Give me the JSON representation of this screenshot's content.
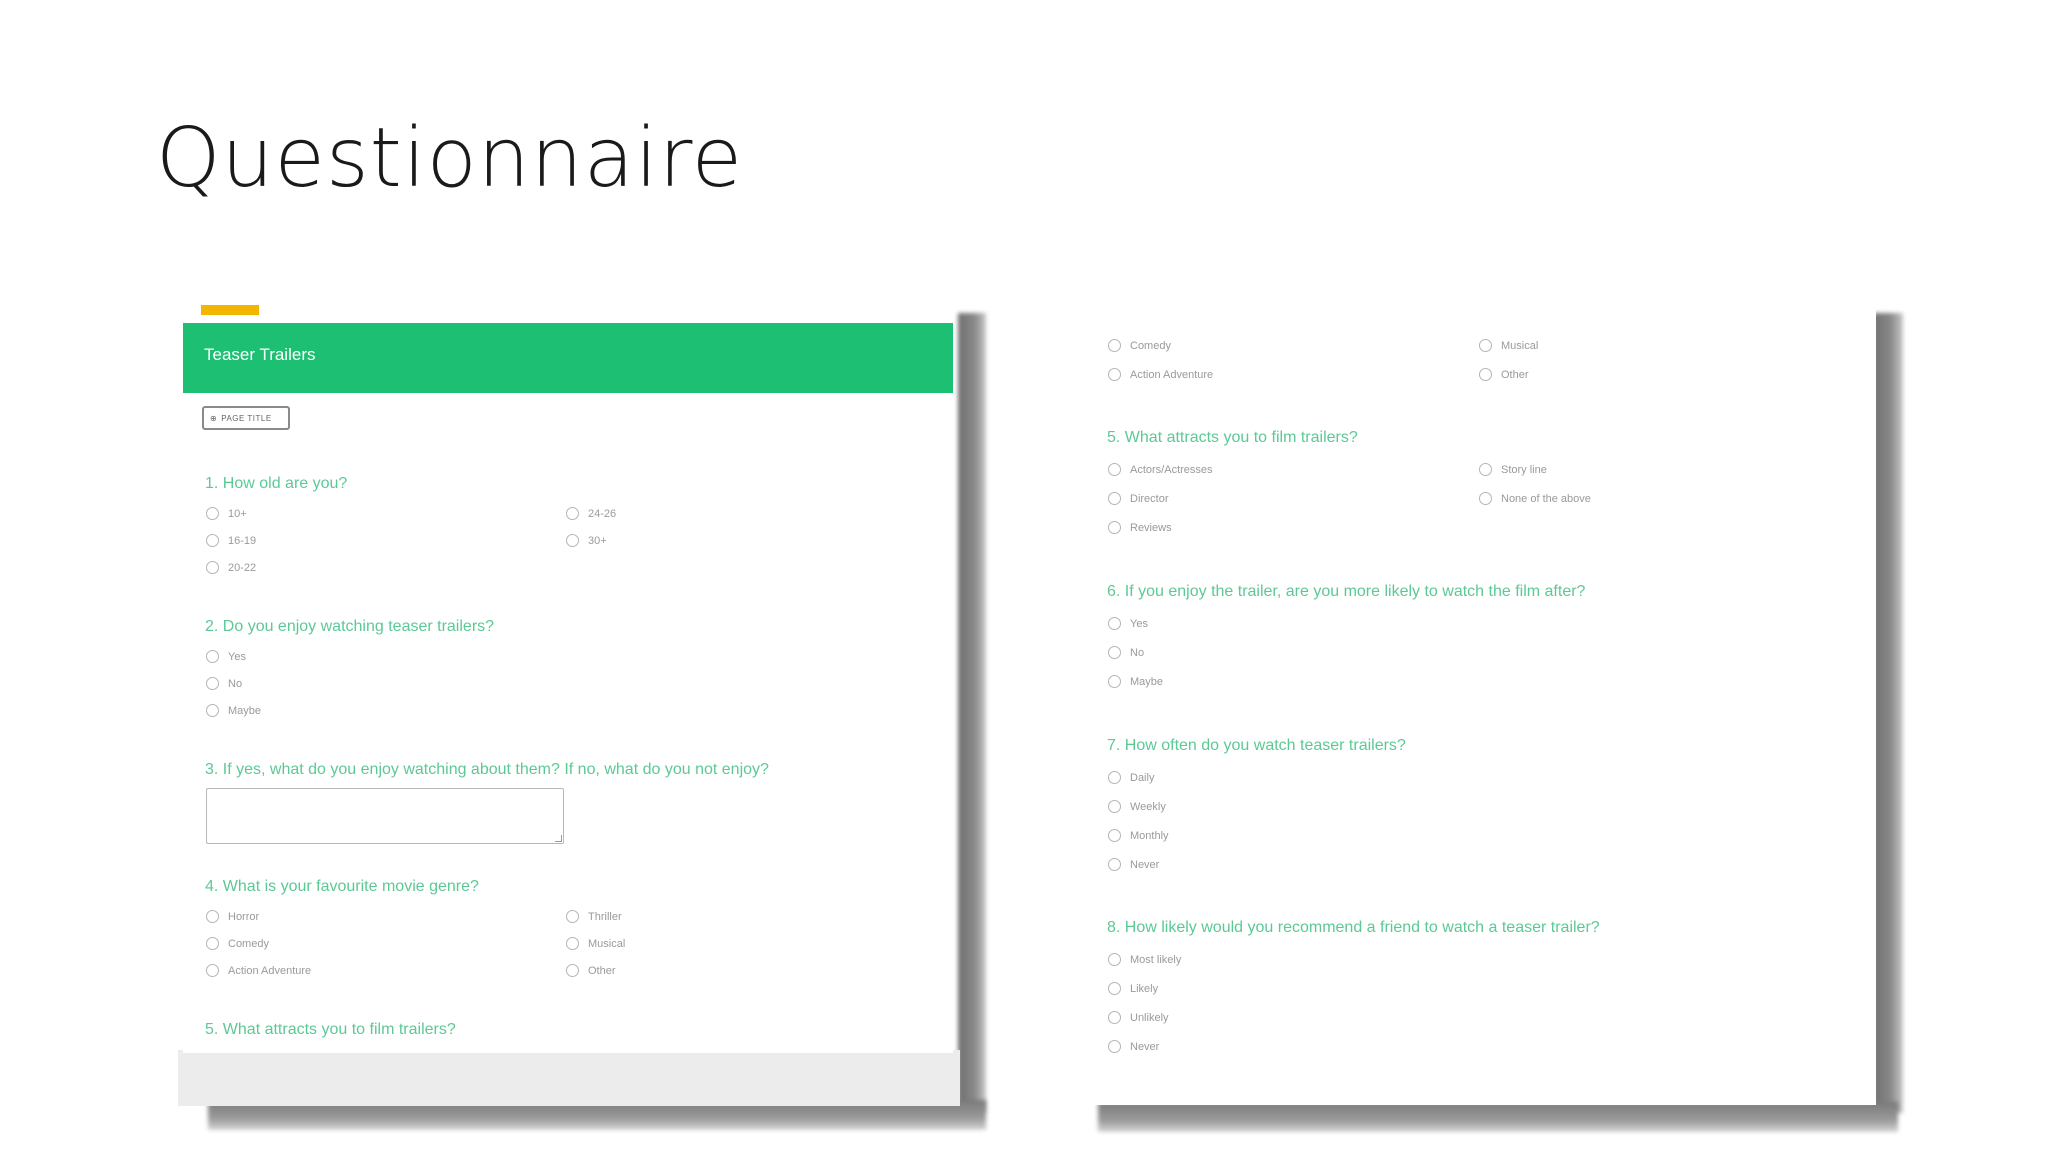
{
  "slide": {
    "title": "Questionnaire"
  },
  "left_shot": {
    "header_title": "Teaser Trailers",
    "page_title_button": "PAGE TITLE",
    "q1": {
      "text": "1. How old are you?",
      "col1": [
        "10+",
        "16-19",
        "20-22"
      ],
      "col2": [
        "24-26",
        "30+"
      ]
    },
    "q2": {
      "text": "2. Do you enjoy watching teaser trailers?",
      "options": [
        "Yes",
        "No",
        "Maybe"
      ]
    },
    "q3": {
      "text": "3. If yes, what do you enjoy watching about them? If no, what do you not enjoy?"
    },
    "q4": {
      "text": "4. What is your favourite movie genre?",
      "col1": [
        "Horror",
        "Comedy",
        "Action Adventure"
      ],
      "col2": [
        "Thriller",
        "Musical",
        "Other"
      ]
    },
    "q5": {
      "text": "5. What attracts you to film trailers?"
    }
  },
  "right_shot": {
    "q4_cont": {
      "col1": [
        "Comedy",
        "Action Adventure"
      ],
      "col2": [
        "Musical",
        "Other"
      ]
    },
    "q5": {
      "text": "5. What attracts you to film trailers?",
      "col1": [
        "Actors/Actresses",
        "Director",
        "Reviews"
      ],
      "col2": [
        "Story line",
        "None of the above"
      ]
    },
    "q6": {
      "text": "6. If you enjoy the trailer, are you more likely to watch the film after?",
      "options": [
        "Yes",
        "No",
        "Maybe"
      ]
    },
    "q7": {
      "text": "7. How often do you watch teaser trailers?",
      "options": [
        "Daily",
        "Weekly",
        "Monthly",
        "Never"
      ]
    },
    "q8": {
      "text": "8. How likely would you recommend a friend to watch a teaser trailer?",
      "options": [
        "Most likely",
        "Likely",
        "Unlikely",
        "Never"
      ]
    }
  },
  "colors": {
    "accent": "#1dbf73",
    "question_text": "#5cc995",
    "tab": "#f2b600"
  }
}
